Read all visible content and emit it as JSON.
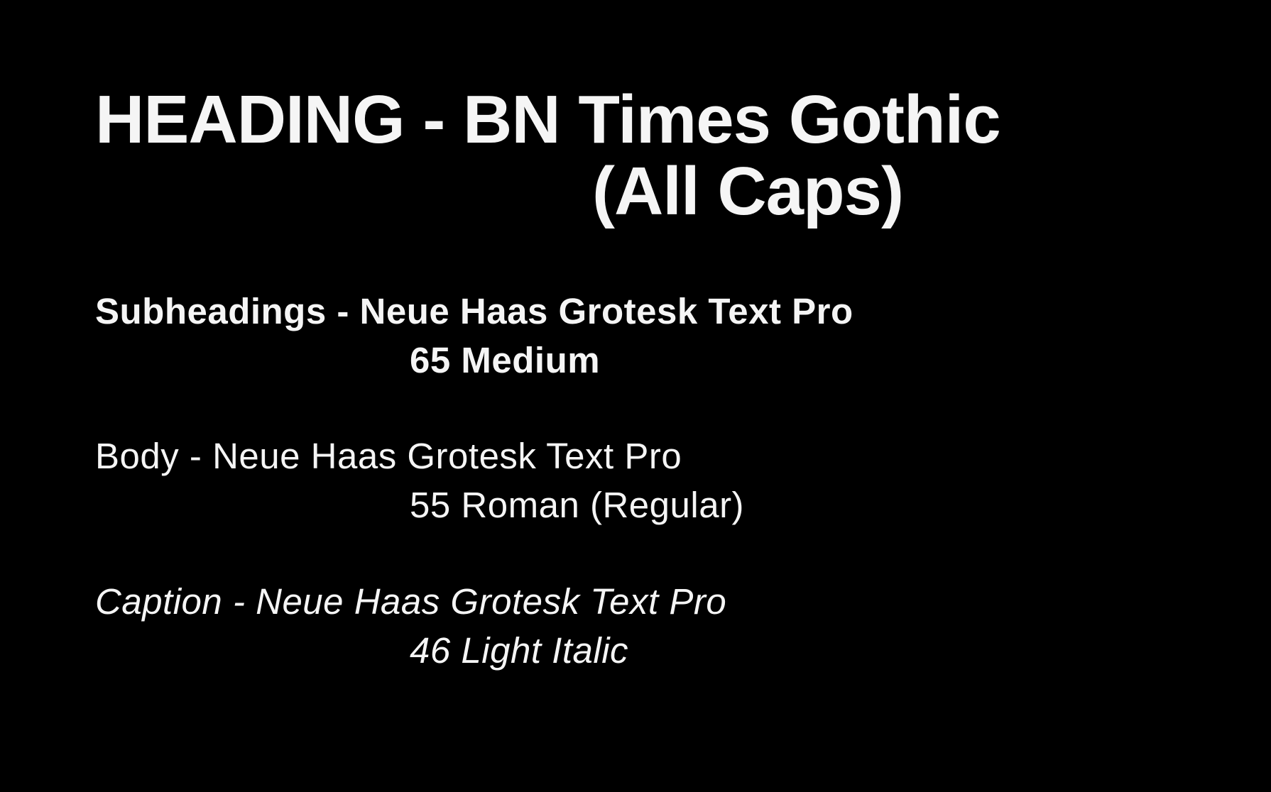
{
  "background_color": "#000000",
  "text_color": "#f5f5f5",
  "heading": {
    "line1": "HEADING - BN Times Gothic",
    "line2": "(All Caps)"
  },
  "subheading": {
    "line1": "Subheadings - Neue Haas Grotesk Text Pro",
    "line2": "65 Medium"
  },
  "body": {
    "line1": "Body - Neue Haas Grotesk Text Pro",
    "line2": "55 Roman (Regular)"
  },
  "caption": {
    "line1": "Caption - Neue Haas Grotesk Text Pro",
    "line2": "46 Light Italic"
  }
}
